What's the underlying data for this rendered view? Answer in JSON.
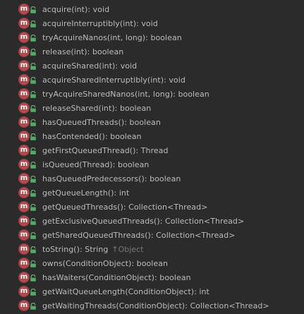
{
  "icons": {
    "method_letter": "m",
    "method_icon_name": "method-icon",
    "visibility_icon_name": "public-lock-icon",
    "method_color": "#b04a4f",
    "visibility_color": "#59a869"
  },
  "methods": [
    {
      "label": "acquire(int): void"
    },
    {
      "label": "acquireInterruptibly(int): void"
    },
    {
      "label": "tryAcquireNanos(int, long): boolean"
    },
    {
      "label": "release(int): boolean"
    },
    {
      "label": "acquireShared(int): void"
    },
    {
      "label": "acquireSharedInterruptibly(int): void"
    },
    {
      "label": "tryAcquireSharedNanos(int, long): boolean"
    },
    {
      "label": "releaseShared(int): boolean"
    },
    {
      "label": "hasQueuedThreads(): boolean"
    },
    {
      "label": "hasContended(): boolean"
    },
    {
      "label": "getFirstQueuedThread(): Thread"
    },
    {
      "label": "isQueued(Thread): boolean"
    },
    {
      "label": "hasQueuedPredecessors(): boolean"
    },
    {
      "label": "getQueueLength(): int"
    },
    {
      "label": "getQueuedThreads(): Collection<Thread>"
    },
    {
      "label": "getExclusiveQueuedThreads(): Collection<Thread>"
    },
    {
      "label": "getSharedQueuedThreads(): Collection<Thread>"
    },
    {
      "label": "toString(): String",
      "inherited": "↑Object"
    },
    {
      "label": "owns(ConditionObject): boolean"
    },
    {
      "label": "hasWaiters(ConditionObject): boolean"
    },
    {
      "label": "getWaitQueueLength(ConditionObject): int"
    },
    {
      "label": "getWaitingThreads(ConditionObject): Collection<Thread>"
    }
  ]
}
